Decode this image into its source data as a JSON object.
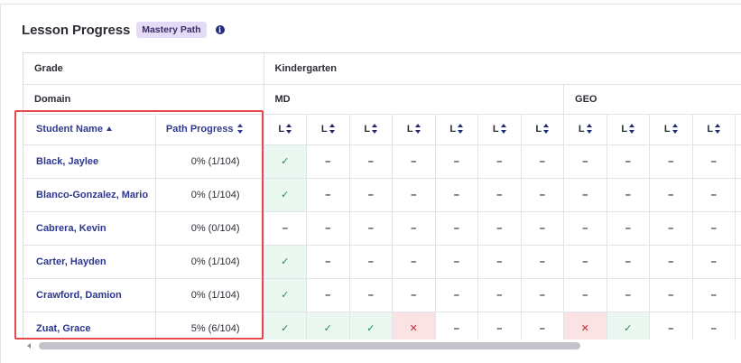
{
  "header": {
    "title": "Lesson Progress",
    "badge": "Mastery Path",
    "info_icon": "info-icon"
  },
  "grid": {
    "grade_label": "Grade",
    "grade_value": "Kindergarten",
    "domain_label": "Domain",
    "domains": [
      {
        "name": "MD",
        "span": 7
      },
      {
        "name": "GEO",
        "span": 5
      }
    ],
    "col_student_name": "Student Name",
    "col_path_progress": "Path Progress",
    "lesson_label": "L",
    "lessons_count": 12,
    "students": [
      {
        "name": "Black, Jaylee",
        "progress": "0% (1/104)",
        "cells": [
          "done",
          "none",
          "none",
          "none",
          "none",
          "none",
          "none",
          "none",
          "none",
          "none",
          "none"
        ]
      },
      {
        "name": "Blanco-Gonzalez, Mario",
        "progress": "0% (1/104)",
        "cells": [
          "done",
          "none",
          "none",
          "none",
          "none",
          "none",
          "none",
          "none",
          "none",
          "none",
          "none"
        ]
      },
      {
        "name": "Cabrera, Kevin",
        "progress": "0% (0/104)",
        "cells": [
          "none",
          "none",
          "none",
          "none",
          "none",
          "none",
          "none",
          "none",
          "none",
          "none",
          "none"
        ]
      },
      {
        "name": "Carter, Hayden",
        "progress": "0% (1/104)",
        "cells": [
          "done",
          "none",
          "none",
          "none",
          "none",
          "none",
          "none",
          "none",
          "none",
          "none",
          "none"
        ]
      },
      {
        "name": "Crawford, Damion",
        "progress": "0% (1/104)",
        "cells": [
          "done",
          "none",
          "none",
          "none",
          "none",
          "none",
          "none",
          "none",
          "none",
          "none",
          "none"
        ]
      },
      {
        "name": "Zuat, Grace",
        "progress": "5% (6/104)",
        "cells": [
          "done",
          "done",
          "done",
          "fail",
          "none",
          "none",
          "none",
          "fail",
          "done",
          "none",
          "none"
        ]
      }
    ],
    "symbols": {
      "done": "✓",
      "fail": "✕",
      "none": "–"
    }
  },
  "colors": {
    "accent": "#2f3a8f",
    "done_bg": "#ebf8f1",
    "fail_bg": "#fbe3e5",
    "highlight": "#e5484d"
  }
}
